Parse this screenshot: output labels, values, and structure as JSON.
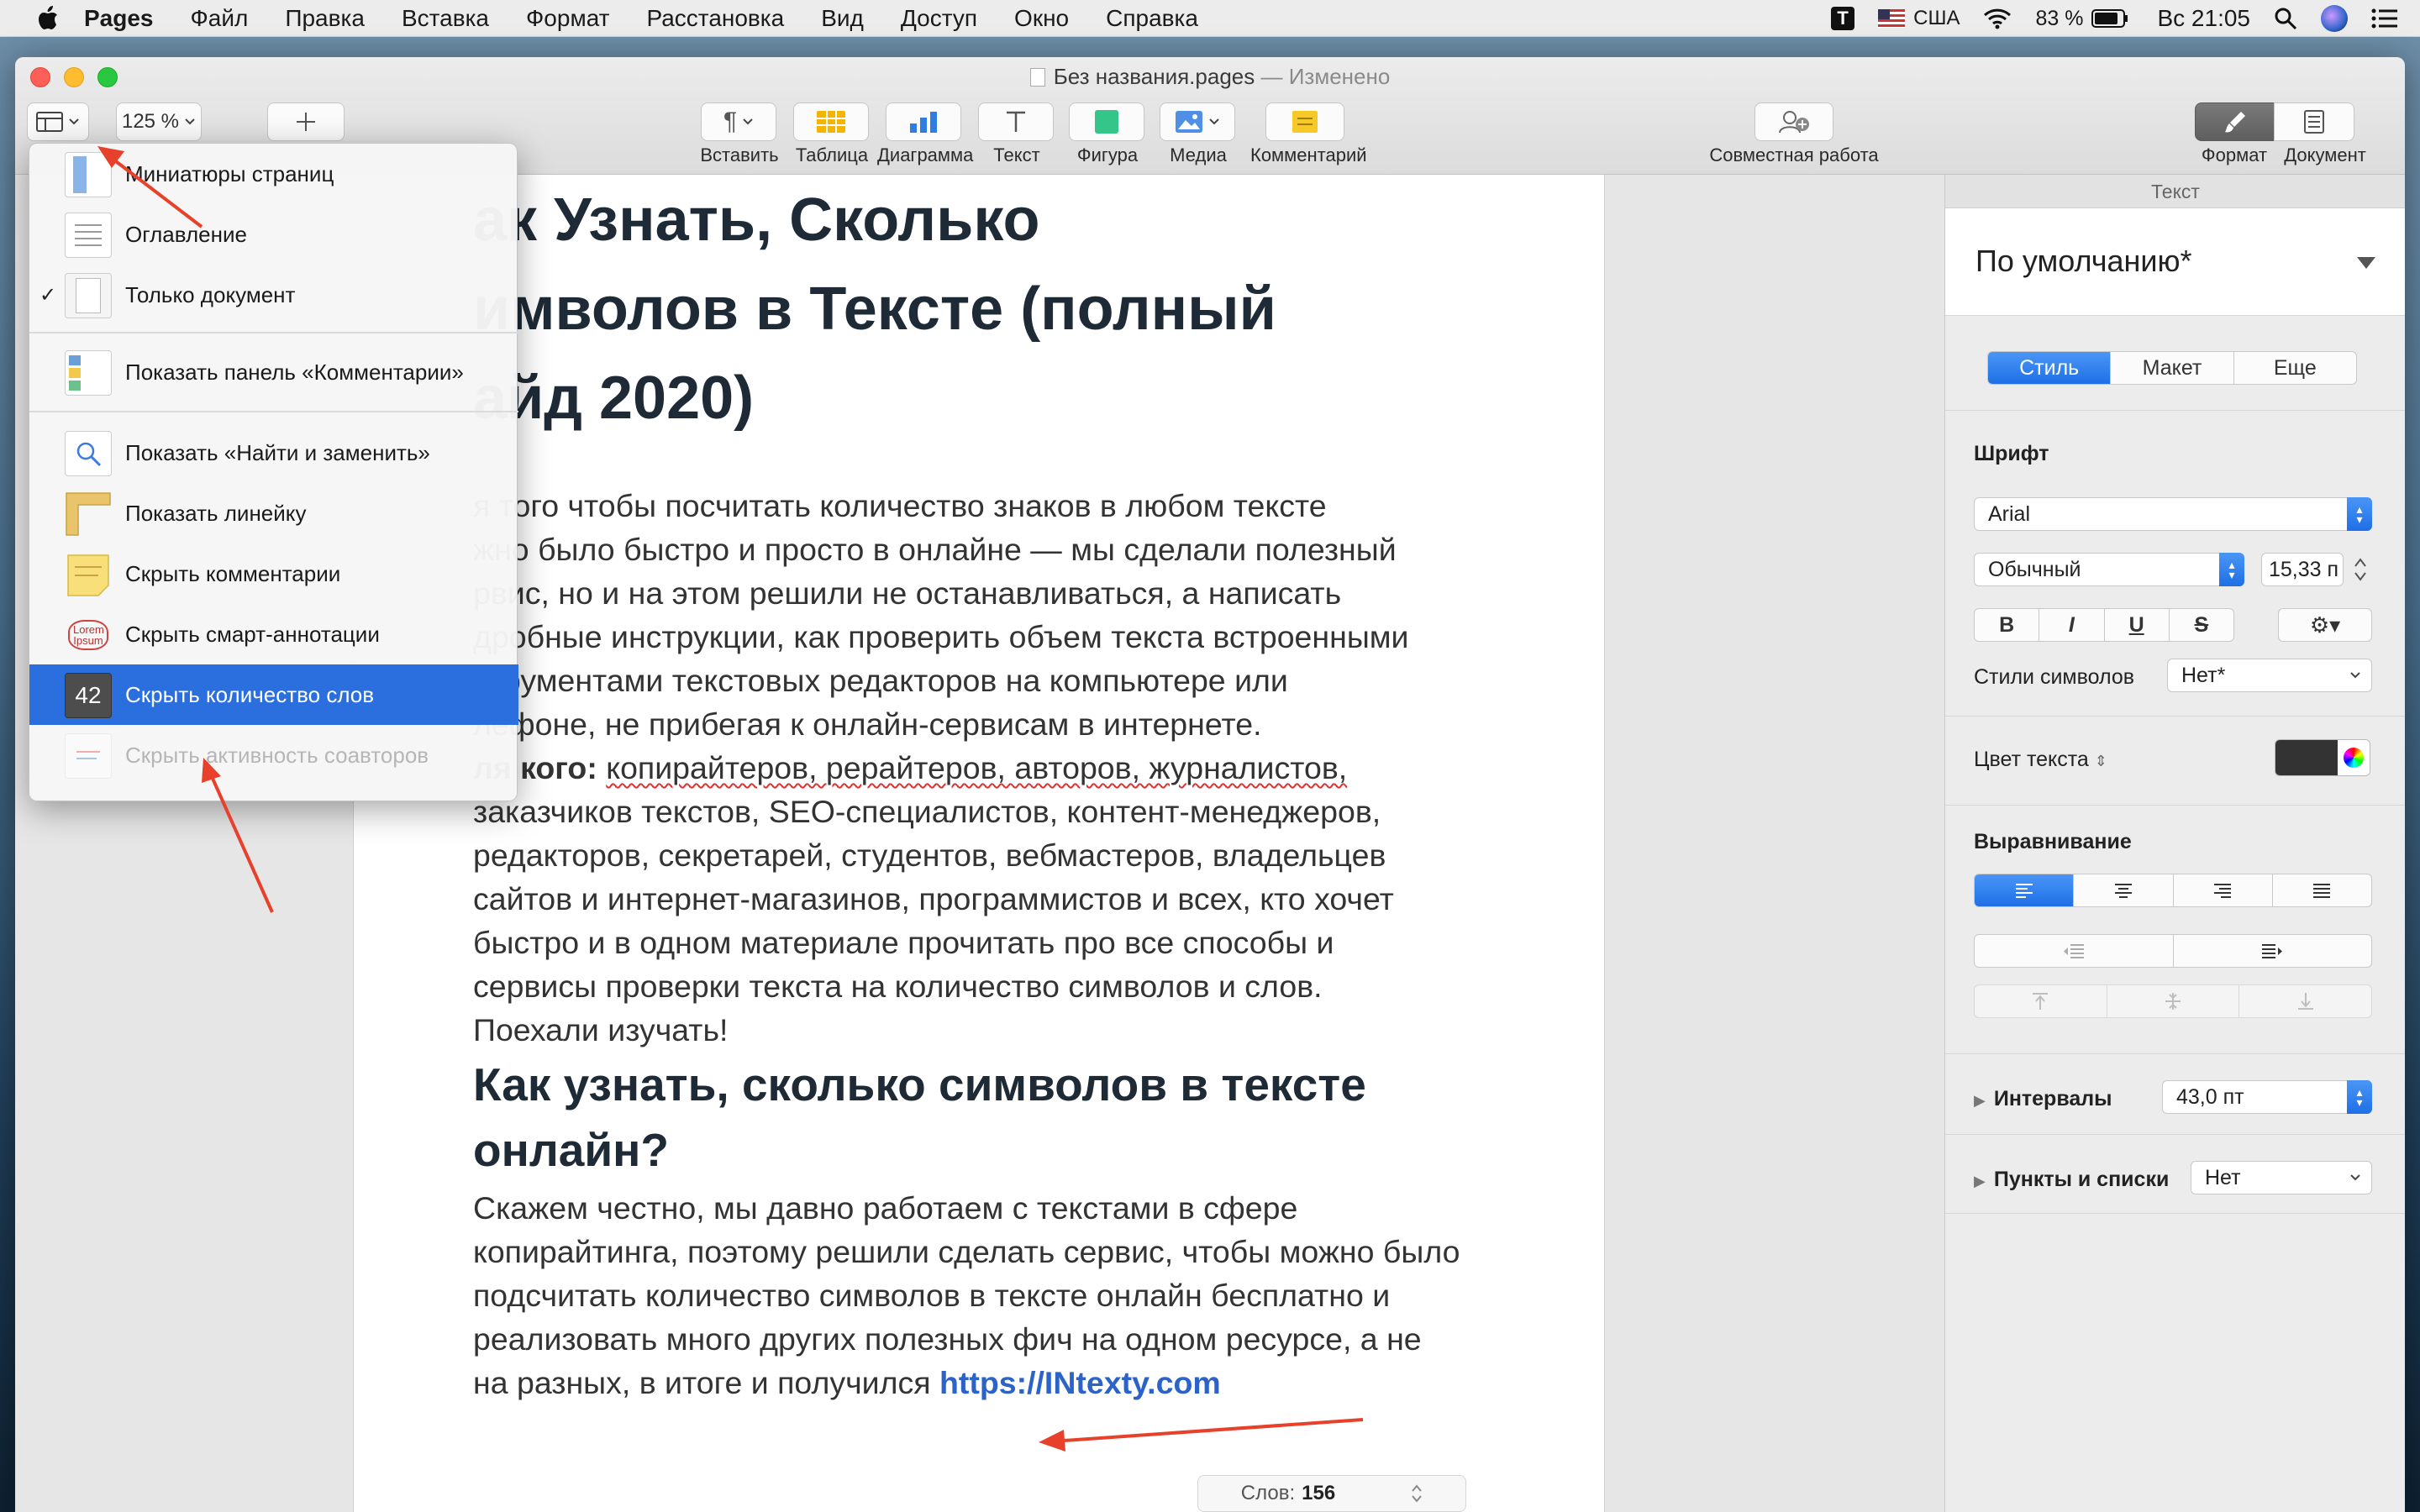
{
  "menubar": {
    "app": "Pages",
    "items": [
      "Файл",
      "Правка",
      "Вставка",
      "Формат",
      "Расстановка",
      "Вид",
      "Доступ",
      "Окно",
      "Справка"
    ],
    "input_lang": "США",
    "battery": "83 %",
    "clock": "Вс 21:05"
  },
  "window": {
    "title": "Без названия.pages",
    "status": "— Изменено",
    "zoom": "125 %",
    "toolbar": {
      "insert": "Вставить",
      "table": "Таблица",
      "chart": "Диаграмма",
      "text": "Текст",
      "shape": "Фигура",
      "media": "Медиа",
      "comment": "Комментарий",
      "collab": "Совместная работа",
      "format": "Формат",
      "document": "Документ"
    }
  },
  "view_menu": {
    "items": [
      {
        "label": "Миниатюры страниц",
        "checked": false
      },
      {
        "label": "Оглавление",
        "checked": false
      },
      {
        "label": "Только документ",
        "checked": true
      },
      {
        "label": "Показать панель «Комментарии»"
      },
      {
        "label": "Показать «Найти и заменить»"
      },
      {
        "label": "Показать линейку"
      },
      {
        "label": "Скрыть комментарии"
      },
      {
        "label": "Скрыть смарт-аннотации",
        "icon_text": "Lorem Ipsum"
      },
      {
        "label": "Скрыть количество слов",
        "icon_text": "42",
        "selected": true
      },
      {
        "label": "Скрыть активность соавторов",
        "disabled": true
      }
    ]
  },
  "document": {
    "title_lines": [
      "ак Узнать, Сколько",
      "имволов в Тексте (полный",
      "айд 2020)"
    ],
    "intro_lines": [
      "я того чтобы посчитать количество знаков в любом тексте",
      "жно было быстро и просто в онлайне — мы сделали полезный",
      "рвис, но и на этом решили не останавливаться, а написать",
      "дробные инструкции, как проверить объем текста встроенными",
      "струментами текстовых редакторов на компьютере или",
      "лефоне, не прибегая к онлайн-сервисам в интернете."
    ],
    "audience": {
      "bold": "ля кого:",
      "line1_rest": "копирайтеров, рерайтеров, авторов, журналистов,",
      "lines": [
        "заказчиков текстов, SEO-специалистов, контент-менеджеров,",
        "редакторов, секретарей, студентов, вебмастеров, владельцев",
        "сайтов и интернет-магазинов, программистов и всех, кто хочет",
        "быстро и в одном материале прочитать про все способы и",
        "сервисы проверки текста на количество символов и слов.",
        "Поехали изучать!"
      ]
    },
    "h2_lines": [
      "Как узнать, сколько символов в тексте",
      "онлайн?"
    ],
    "body_lines": [
      "Скажем честно, мы давно работаем с текстами в сфере",
      "копирайтинга, поэтому решили сделать сервис, чтобы можно было",
      "подсчитать количество символов в тексте онлайн бесплатно и",
      "реализовать много других полезных фич на одном ресурсе, а не"
    ],
    "last_line_text": "на разных, в итоге и получился",
    "link": "https://INtexty.com",
    "word_count_label": "Слов:",
    "word_count": "156"
  },
  "sidebar": {
    "header": "Текст",
    "style_name": "По умолчанию*",
    "tabs": [
      "Стиль",
      "Макет",
      "Еще"
    ],
    "font_label": "Шрифт",
    "font": "Arial",
    "typeface": "Обычный",
    "size": "15,33 п",
    "format_buttons": [
      "B",
      "I",
      "U",
      "S"
    ],
    "char_styles_label": "Стили символов",
    "char_styles_value": "Нет*",
    "text_color_label": "Цвет текста",
    "text_color": "#333333",
    "alignment_label": "Выравнивание",
    "spacing_label": "Интервалы",
    "spacing_value": "43,0 пт",
    "lists_label": "Пункты и списки",
    "lists_value": "Нет"
  },
  "colors": {
    "accent": "#2b6fde",
    "arrow": "#e8412b",
    "link": "#2b63c9"
  }
}
